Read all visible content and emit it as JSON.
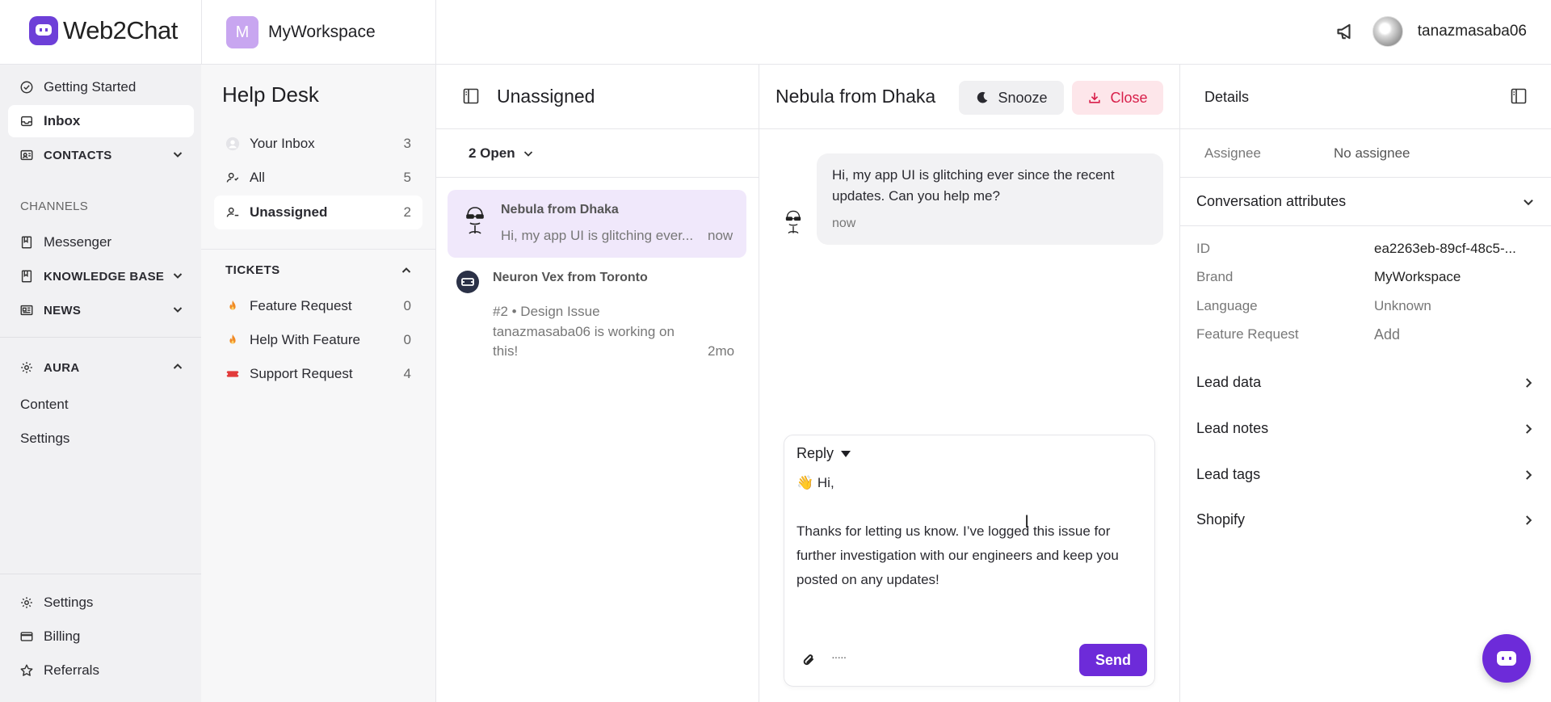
{
  "app": {
    "logo_text": "Web2Chat",
    "brand_color": "#6d2bd9"
  },
  "workspace": {
    "initial": "M",
    "name": "MyWorkspace"
  },
  "user": {
    "name": "tanazmasaba06"
  },
  "leftnav": {
    "getting_started": "Getting Started",
    "inbox": "Inbox",
    "contacts": "CONTACTS",
    "channels_heading": "CHANNELS",
    "messenger": "Messenger",
    "knowledge_base": "KNOWLEDGE BASE",
    "news": "NEWS",
    "aura": "AURA",
    "content": "Content",
    "aura_settings": "Settings",
    "settings": "Settings",
    "billing": "Billing",
    "referrals": "Referrals"
  },
  "helpdesk": {
    "title": "Help Desk",
    "items": [
      {
        "label": "Your Inbox",
        "count": "3"
      },
      {
        "label": "All",
        "count": "5"
      },
      {
        "label": "Unassigned",
        "count": "2"
      }
    ],
    "tickets_heading": "TICKETS",
    "tickets": [
      {
        "label": "Feature Request",
        "count": "0"
      },
      {
        "label": "Help With Feature",
        "count": "0"
      },
      {
        "label": "Support Request",
        "count": "4"
      }
    ]
  },
  "convlist": {
    "title": "Unassigned",
    "filter": "2 Open",
    "items": [
      {
        "name": "Nebula from Dhaka",
        "preview": "Hi, my app UI is glitching ever...",
        "time": "now"
      },
      {
        "name": "Neuron Vex from Toronto",
        "line1": "#2 • Design Issue",
        "line2": "tanazmasaba06 is working on",
        "line3": "this!",
        "time": "2mo"
      }
    ]
  },
  "chat": {
    "title": "Nebula from Dhaka",
    "snooze": "Snooze",
    "close": "Close",
    "message": "Hi, my app UI is glitching ever since the recent updates. Can you help me?",
    "message_time": "now",
    "reply_mode": "Reply",
    "reply_text": "👋 Hi,\n\nThanks for letting us know. I’ve logged this issue for further investigation with our engineers and keep you posted on any updates!",
    "send": "Send"
  },
  "details": {
    "title": "Details",
    "assignee_label": "Assignee",
    "assignee_value": "No assignee",
    "conv_attrs": "Conversation attributes",
    "attrs": [
      {
        "label": "ID",
        "value": "ea2263eb-89cf-48c5-..."
      },
      {
        "label": "Brand",
        "value": "MyWorkspace"
      },
      {
        "label": "Language",
        "value": "Unknown"
      },
      {
        "label": "Feature Request",
        "value": "Add"
      }
    ],
    "sections": [
      "Lead data",
      "Lead notes",
      "Lead tags",
      "Shopify"
    ]
  }
}
